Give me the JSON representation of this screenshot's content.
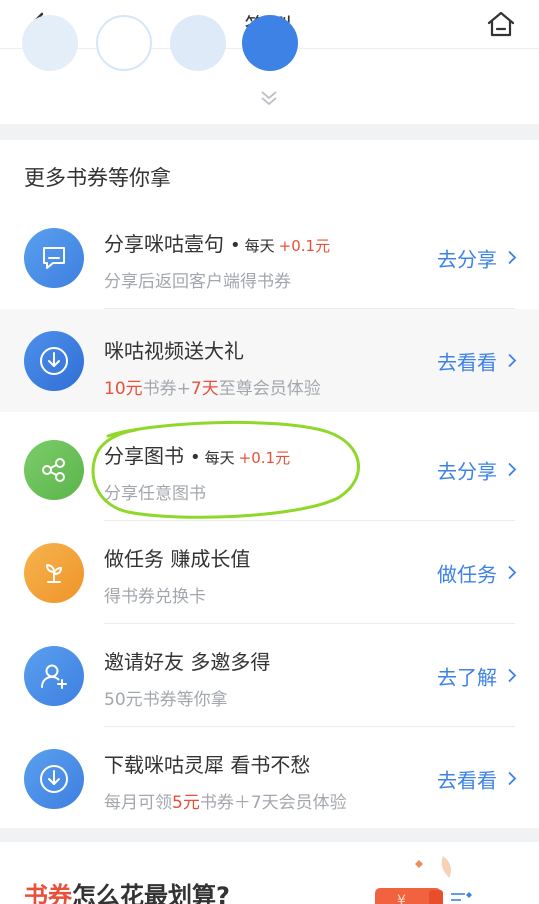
{
  "header": {
    "title": "签到"
  },
  "section": {
    "title": "更多书券等你拿",
    "tasks": [
      {
        "title": "分享咪咕壹句",
        "dot": "•",
        "daily": "每天",
        "reward": "+0.1元",
        "subtitle": "分享后返回客户端得书券",
        "action": "去分享",
        "icon": "chat-bubble-icon",
        "color": "#4a90e8"
      },
      {
        "title": "咪咕视频送大礼",
        "sub_pre": "10元",
        "sub_mid1": "书券+",
        "sub_hl2": "7天",
        "sub_post": "至尊会员体验",
        "action": "去看看",
        "icon": "download-icon",
        "color": "#3b7de0"
      },
      {
        "title": "分享图书",
        "dot": "•",
        "daily": "每天",
        "reward": "+0.1元",
        "subtitle": "分享任意图书",
        "action": "去分享",
        "icon": "share-nodes-icon",
        "color": "#6ec05e"
      },
      {
        "title": "做任务 赚成长值",
        "subtitle": "得书券兑换卡",
        "action": "做任务",
        "icon": "sprout-icon",
        "color": "#f2a23a"
      },
      {
        "title": "邀请好友 多邀多得",
        "subtitle": "50元书券等你拿",
        "action": "去了解",
        "icon": "add-user-icon",
        "color": "#4a90e8"
      },
      {
        "title": "下载咪咕灵犀 看书不愁",
        "sub_pre": "每月可领",
        "sub_hl": "5元",
        "sub_post": "书券＋7天会员体验",
        "action": "去看看",
        "icon": "download-icon",
        "color": "#4a90e8"
      }
    ]
  },
  "bottom": {
    "title_red": "书券",
    "title_rest": "怎么花最划算?",
    "coupon_symbol": "¥"
  },
  "colors": {
    "accent": "#3e82e5",
    "highlight": "#e8503a",
    "annotation": "#8fd82a"
  }
}
